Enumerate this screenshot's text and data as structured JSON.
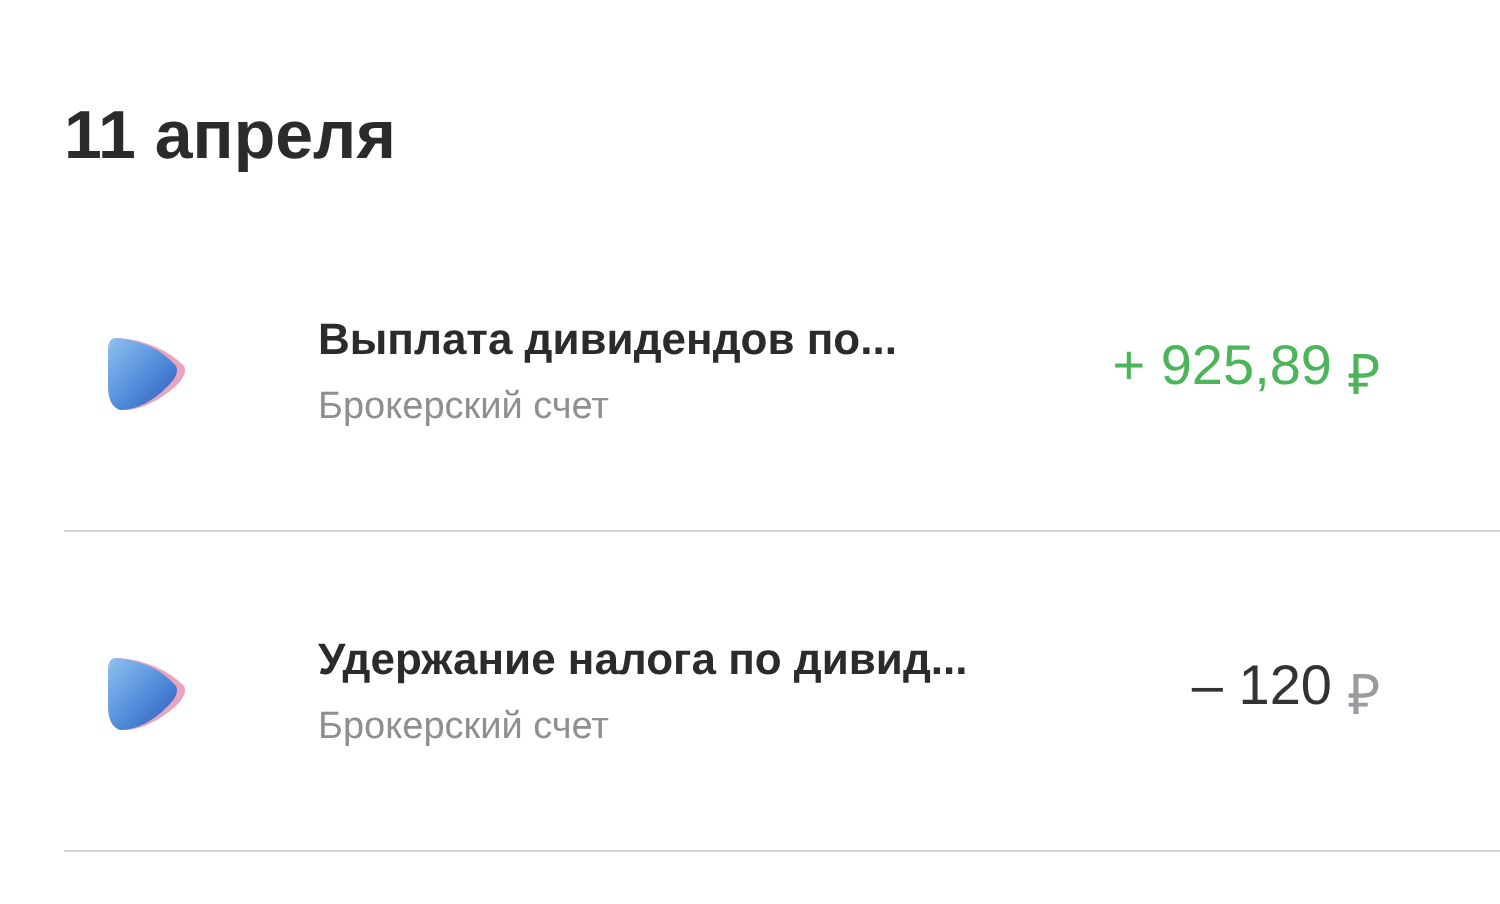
{
  "date_heading": "11 апреля",
  "operations": [
    {
      "title": "Выплата дивидендов по...",
      "subtitle": "Брокерский счет",
      "kind": "income",
      "amount": "+ 925,89",
      "currency": "₽"
    },
    {
      "title": "Удержание налога по дивид...",
      "subtitle": "Брокерский счет",
      "kind": "expense",
      "amount": "– 120",
      "currency": "₽"
    }
  ]
}
